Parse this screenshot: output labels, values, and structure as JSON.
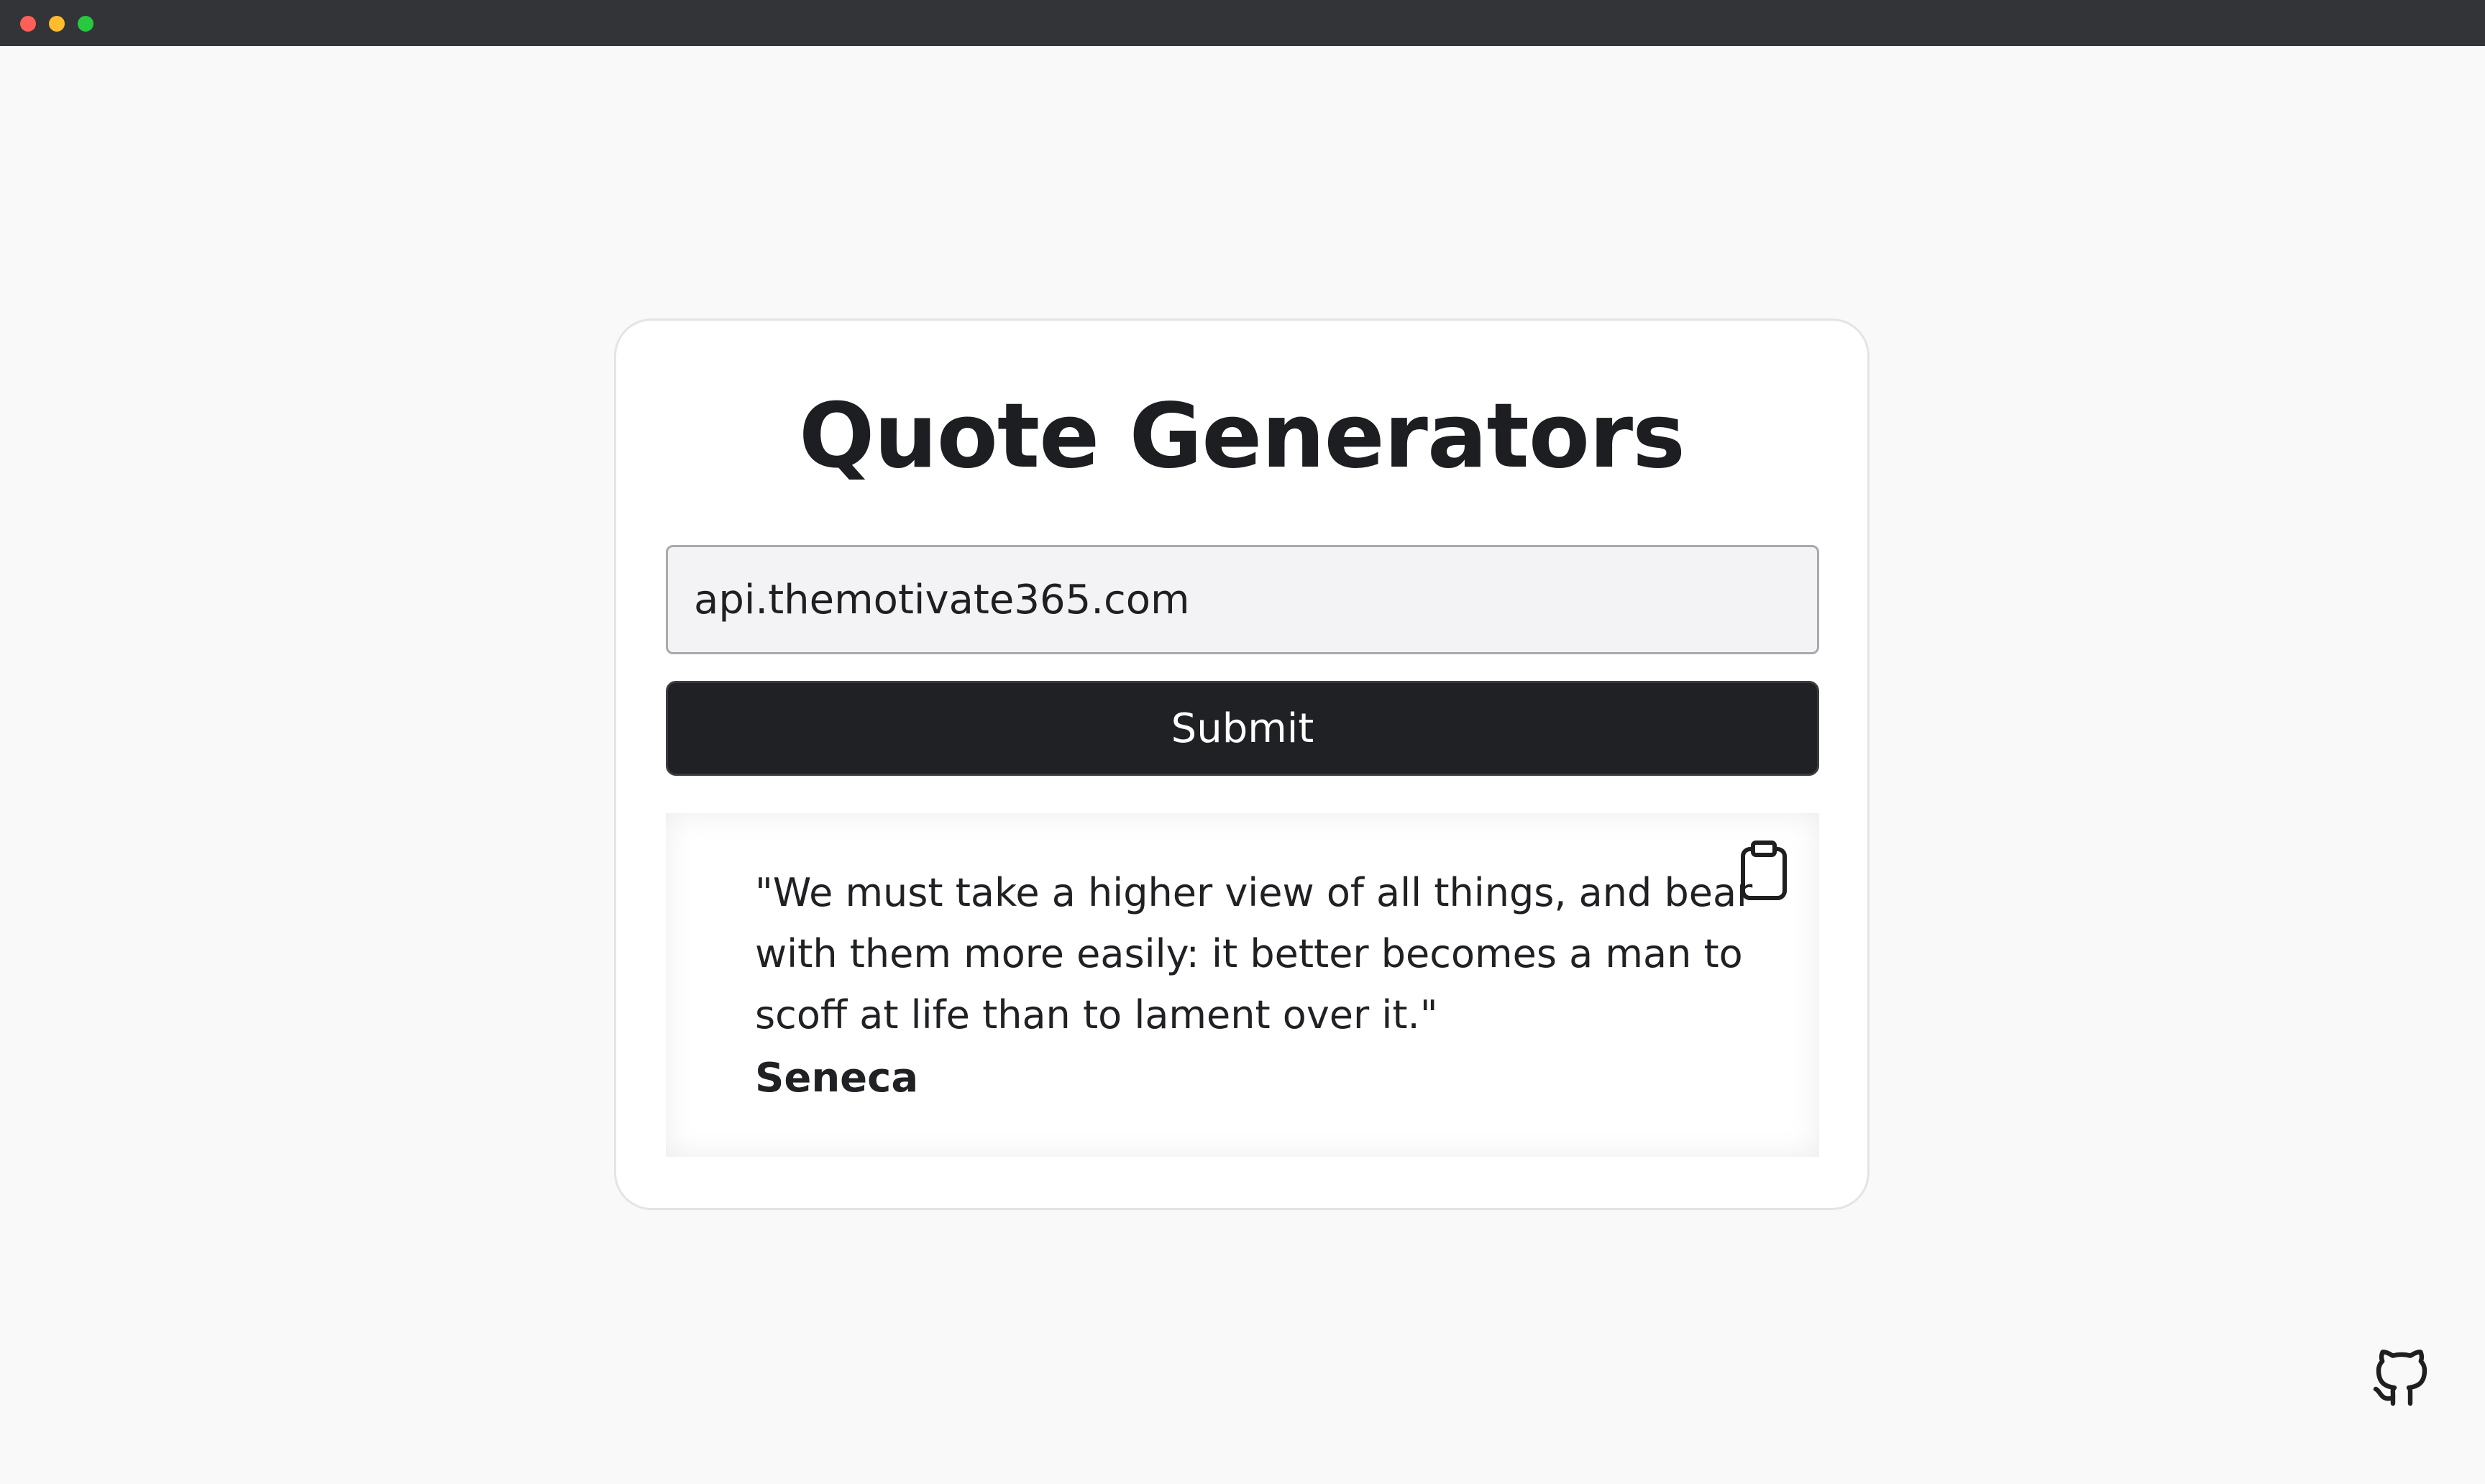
{
  "window": {
    "controls": [
      "close",
      "minimize",
      "maximize"
    ]
  },
  "card": {
    "title": "Quote Generators",
    "url_input": {
      "value": "api.themotivate365.com",
      "placeholder": ""
    },
    "submit_label": "Submit",
    "quote": {
      "text": "\"We must take a higher view of all things, and bear with them more easily: it better becomes a man to scoff at life than to lament over it.\"",
      "author": "Seneca",
      "copy_icon": "clipboard-icon"
    }
  },
  "footer": {
    "github_icon": "github-icon"
  },
  "colors": {
    "background": "#f9f9f9",
    "card": "#ffffff",
    "button": "#202124",
    "text": "#202124"
  }
}
